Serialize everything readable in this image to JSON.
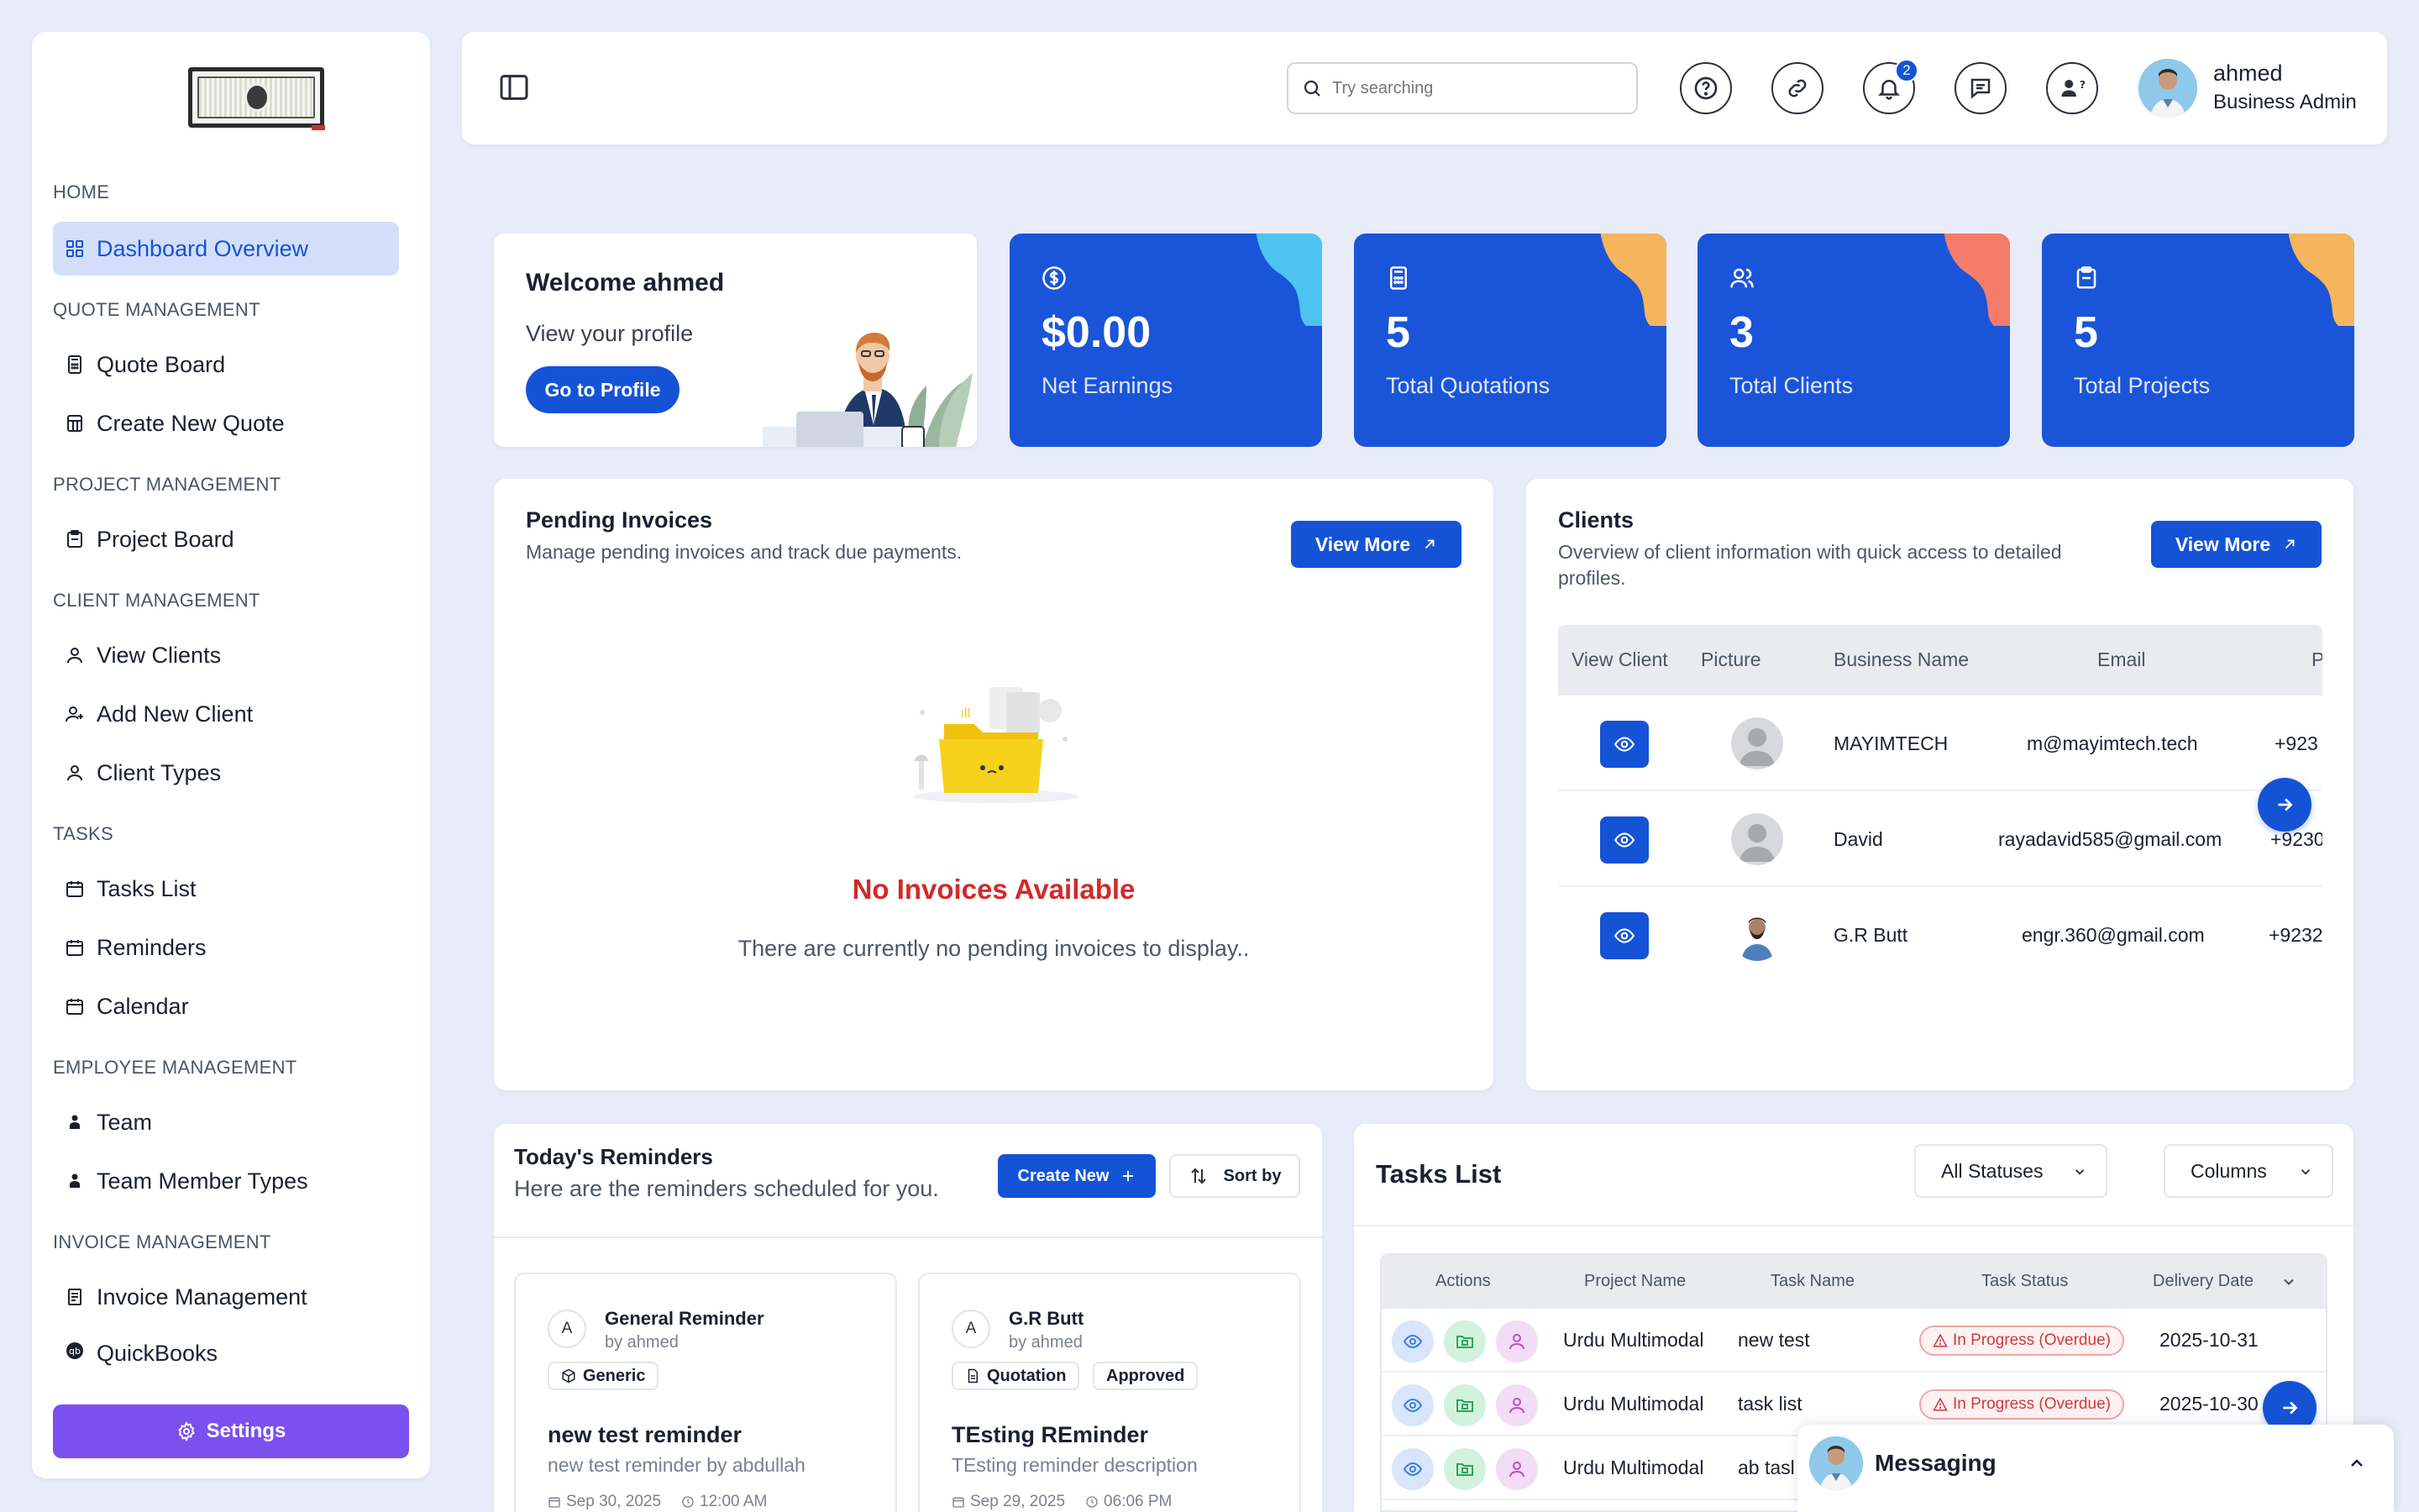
{
  "sidebar": {
    "sections": {
      "home": "HOME",
      "quote": "QUOTE MANAGEMENT",
      "project": "PROJECT MANAGEMENT",
      "client": "CLIENT MANAGEMENT",
      "tasks": "TASKS",
      "employee": "EMPLOYEE MANAGEMENT",
      "invoice": "INVOICE MANAGEMENT"
    },
    "items": {
      "dashboard": "Dashboard Overview",
      "quote_board": "Quote Board",
      "create_quote": "Create New Quote",
      "project_board": "Project Board",
      "view_clients": "View Clients",
      "add_client": "Add New Client",
      "client_types": "Client Types",
      "tasks_list": "Tasks List",
      "reminders": "Reminders",
      "calendar": "Calendar",
      "team": "Team",
      "team_member_types": "Team Member Types",
      "invoice_management": "Invoice Management",
      "quickbooks": "QuickBooks"
    },
    "settings": "Settings"
  },
  "topbar": {
    "search_placeholder": "Try searching",
    "notification_count": "2",
    "user_name": "ahmed",
    "user_role": "Business Admin"
  },
  "welcome": {
    "title": "Welcome ahmed",
    "subtitle": "View your profile",
    "button": "Go to Profile"
  },
  "stats": [
    {
      "value": "$0.00",
      "label": "Net Earnings",
      "icon": "dollar-icon",
      "accent": "#4fc3ef"
    },
    {
      "value": "5",
      "label": "Total Quotations",
      "icon": "calculator-icon",
      "accent": "#f6b45c"
    },
    {
      "value": "3",
      "label": "Total Clients",
      "icon": "users-icon",
      "accent": "#f47c6a"
    },
    {
      "value": "5",
      "label": "Total Projects",
      "icon": "clipboard-icon",
      "accent": "#f6b45c"
    }
  ],
  "invoices": {
    "title": "Pending Invoices",
    "subtitle": "Manage pending invoices and track due payments.",
    "button": "View More",
    "empty_title": "No Invoices Available",
    "empty_text": "There are currently no pending invoices to display.."
  },
  "clients": {
    "title": "Clients",
    "subtitle": "Overview of client information with quick access to detailed profiles.",
    "button": "View More",
    "columns": [
      "View Client",
      "Picture",
      "Business Name",
      "Email",
      "P"
    ],
    "rows": [
      {
        "name": "MAYIMTECH",
        "email": "m@mayimtech.tech",
        "phone": "+923"
      },
      {
        "name": "David",
        "email": "rayadavid585@gmail.com",
        "phone": "+9230"
      },
      {
        "name": "G.R Butt",
        "email": "engr.360@gmail.com",
        "phone": "+9232"
      }
    ]
  },
  "reminders": {
    "title": "Today's Reminders",
    "subtitle": "Here are the reminders scheduled for you.",
    "create_button": "Create New",
    "sort_button": "Sort by",
    "cards": [
      {
        "avatar": "A",
        "name": "General Reminder",
        "by": "by ahmed",
        "tags": [
          "Generic"
        ],
        "title": "new test reminder",
        "desc": "new test reminder by abdullah",
        "date": "Sep 30, 2025",
        "time": "12:00 AM"
      },
      {
        "avatar": "A",
        "name": "G.R Butt",
        "by": "by ahmed",
        "tags": [
          "Quotation",
          "Approved"
        ],
        "title": "TEsting REminder",
        "desc": "TEsting reminder description",
        "date": "Sep 29, 2025",
        "time": "06:06 PM"
      }
    ]
  },
  "tasks": {
    "title": "Tasks List",
    "status_filter": "All Statuses",
    "columns_button": "Columns",
    "columns": [
      "Actions",
      "Project Name",
      "Task Name",
      "Task Status",
      "Delivery Date"
    ],
    "rows": [
      {
        "project": "Urdu Multimodal",
        "task": "new test",
        "status": "In Progress (Overdue)",
        "date": "2025-10-31"
      },
      {
        "project": "Urdu Multimodal",
        "task": "task list",
        "status": "In Progress (Overdue)",
        "date": "2025-10-30"
      },
      {
        "project": "Urdu Multimodal",
        "task": "ab tasl",
        "status": "",
        "date": ""
      }
    ]
  },
  "messaging": {
    "label": "Messaging"
  }
}
